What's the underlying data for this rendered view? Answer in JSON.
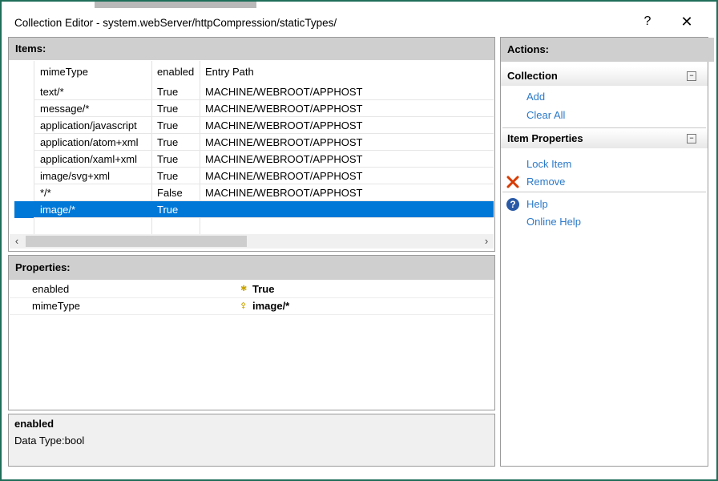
{
  "window": {
    "title": "Collection Editor - system.webServer/httpCompression/staticTypes/",
    "help_label": "?",
    "close_label": "✕"
  },
  "items": {
    "header": "Items:",
    "columns": [
      "mimeType",
      "enabled",
      "Entry Path"
    ],
    "rows": [
      {
        "mimeType": "text/*",
        "enabled": "True",
        "path": "MACHINE/WEBROOT/APPHOST"
      },
      {
        "mimeType": "message/*",
        "enabled": "True",
        "path": "MACHINE/WEBROOT/APPHOST"
      },
      {
        "mimeType": "application/javascript",
        "enabled": "True",
        "path": "MACHINE/WEBROOT/APPHOST"
      },
      {
        "mimeType": "application/atom+xml",
        "enabled": "True",
        "path": "MACHINE/WEBROOT/APPHOST"
      },
      {
        "mimeType": "application/xaml+xml",
        "enabled": "True",
        "path": "MACHINE/WEBROOT/APPHOST"
      },
      {
        "mimeType": "image/svg+xml",
        "enabled": "True",
        "path": "MACHINE/WEBROOT/APPHOST"
      },
      {
        "mimeType": "*/*",
        "enabled": "False",
        "path": "MACHINE/WEBROOT/APPHOST"
      },
      {
        "mimeType": "image/*",
        "enabled": "True",
        "path": ""
      }
    ],
    "selected_index": 7
  },
  "properties": {
    "header": "Properties:",
    "rows": [
      {
        "name": "enabled",
        "value": "True",
        "icon": "required-icon"
      },
      {
        "name": "mimeType",
        "value": "image/*",
        "icon": "key-icon"
      }
    ]
  },
  "description": {
    "title": "enabled",
    "text": "Data Type:bool"
  },
  "actions": {
    "header": "Actions:",
    "collection": {
      "title": "Collection",
      "add": "Add",
      "clear_all": "Clear All"
    },
    "item_properties": {
      "title": "Item Properties",
      "lock_item": "Lock Item",
      "remove": "Remove"
    },
    "help": {
      "help": "Help",
      "online_help": "Online Help"
    }
  },
  "colors": {
    "selection": "#0078d7",
    "link": "#2b79c8",
    "frame": "#1e6e5a",
    "remove_icon": "#d83b01",
    "help_icon": "#2a5aa6"
  }
}
